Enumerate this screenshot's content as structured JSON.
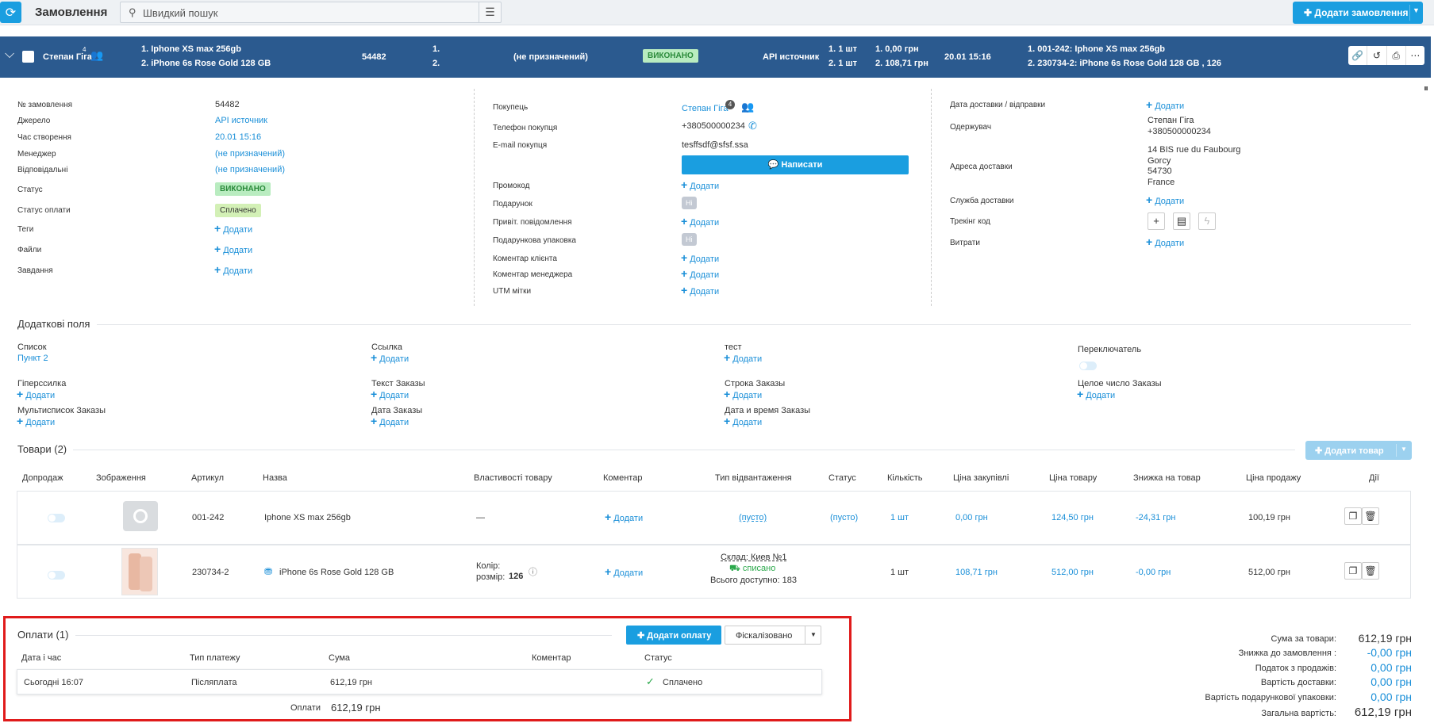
{
  "topbar": {
    "title": "Замовлення",
    "search_placeholder": "Швидкий пошук",
    "add_order_label": "Додати замовлення"
  },
  "order_header": {
    "client": "Степан Гіга",
    "client_badge": "4",
    "items_line1": "1. Iphone XS max 256gb",
    "items_line2": "2. iPhone 6s Rose Gold 128 GB",
    "order_id": "54482",
    "num1": "1.",
    "num2": "2.",
    "manager": "(не призначений)",
    "status": "ВИКОНАНО",
    "source": "API источник",
    "qty1": "1. 1 шт",
    "qty2": "2. 1 шт",
    "price1": "1. 0,00 грн",
    "price2": "2. 108,71 грн",
    "datetime": "20.01 15:16",
    "sku1": "1. 001-242: Iphone XS max 256gb",
    "sku2": "2. 230734-2: iPhone 6s Rose Gold 128 GB , 126"
  },
  "info_left": {
    "order_no_label": "№ замовлення",
    "order_no": "54482",
    "source_label": "Джерело",
    "source": "API источник",
    "created_label": "Час створення",
    "created": "20.01 15:16",
    "manager_label": "Менеджер",
    "manager": "(не призначений)",
    "responsible_label": "Відповідальні",
    "responsible": "(не призначений)",
    "status_label": "Статус",
    "status": "ВИКОНАНО",
    "pay_status_label": "Статус оплати",
    "pay_status": "Сплачено",
    "tags_label": "Теги",
    "files_label": "Файли",
    "tasks_label": "Завдання",
    "add": "Додати"
  },
  "info_mid": {
    "buyer_label": "Покупець",
    "buyer": "Степан Гіга",
    "buyer_badge": "4",
    "phone_label": "Телефон покупця",
    "phone": "+380500000234",
    "email_label": "E-mail покупця",
    "email": "tesffsdf@sfsf.ssa",
    "write_label": "Написати",
    "promo_label": "Промокод",
    "gift_label": "Подарунок",
    "gift": "Ні",
    "greet_label": "Привіт. повідомлення",
    "gift_pack_label": "Подарункова упаковка",
    "gift_pack": "Ні",
    "client_comment_label": "Коментар клієнта",
    "manager_comment_label": "Коментар менеджера",
    "utm_label": "UTM мітки",
    "add": "Додати"
  },
  "info_right": {
    "delivery_date_label": "Дата доставки / відправки",
    "recipient_label": "Одержувач",
    "recipient_name": "Степан Гіга",
    "recipient_phone": "+380500000234",
    "address_label": "Адреса доставки",
    "address1": "14 BIS rue du Faubourg",
    "address2": "Gorcy",
    "address3": "54730",
    "address4": "France",
    "delivery_service_label": "Служба доставки",
    "tracking_label": "Трекінг код",
    "expenses_label": "Витрати",
    "add": "Додати"
  },
  "extra_fields": {
    "title": "Додаткові поля",
    "list_label": "Список",
    "list_value": "Пункт 2",
    "link_label": "Ссылка",
    "test_label": "тест",
    "switch_label": "Переключатель",
    "hyperlink_label": "Гіперссилка",
    "text_label": "Текст Заказы",
    "string_label": "Строка Заказы",
    "int_label": "Целое число Заказы",
    "multi_label": "Мультисписок Заказы",
    "date_label": "Дата Заказы",
    "datetime_label": "Дата и время Заказы",
    "add": "Додати"
  },
  "products": {
    "title": "Товари (2)",
    "add_label": "Додати товар",
    "columns": [
      "Допродаж",
      "Зображення",
      "Артикул",
      "Назва",
      "Властивості товару",
      "Коментар",
      "Тип відвантаження",
      "Статус",
      "Кількість",
      "Ціна закупівлі",
      "Ціна товару",
      "Знижка на товар",
      "Ціна продажу",
      "Дії"
    ],
    "rows": [
      {
        "sku": "001-242",
        "name": "Iphone XS max 256gb",
        "props": "—",
        "comment": "Додати",
        "ship": "(пусто)",
        "status": "(пусто)",
        "qty": "1 шт",
        "purchase": "0,00 грн",
        "price": "124,50 грн",
        "discount": "-24,31 грн",
        "sale": "100,19 грн"
      },
      {
        "sku": "230734-2",
        "name": "iPhone 6s Rose Gold 128 GB",
        "props_color": "Колір:",
        "props_size_label": "розмір:",
        "props_size": "126",
        "comment": "Додати",
        "ship_store": "Склад: Киев №1",
        "ship_state": "списано",
        "ship_avail": "Всього доступно: 183",
        "qty": "1 шт",
        "purchase": "108,71 грн",
        "price": "512,00 грн",
        "discount": "-0,00 грн",
        "sale": "512,00 грн"
      }
    ]
  },
  "payments": {
    "title": "Оплати (1)",
    "add_label": "Додати оплату",
    "fiscal_label": "Фіскалізовано",
    "columns": [
      "Дата і час",
      "Тип платежу",
      "Сума",
      "Коментар",
      "Статус"
    ],
    "row": {
      "date": "Сьогодні 16:07",
      "type": "Післяплата",
      "sum": "612,19 грн",
      "status": "Сплачено"
    },
    "total_label": "Оплати",
    "total": "612,19 грн"
  },
  "totals": {
    "items_label": "Сума за товари:",
    "items": "612,19 грн",
    "discount_label": "Знижка до замовлення :",
    "discount": "-0,00 грн",
    "tax_label": "Податок з продажів:",
    "tax": "0,00 грн",
    "delivery_label": "Вартість доставки:",
    "delivery": "0,00 грн",
    "giftpack_label": "Вартість подарункової упаковки:",
    "giftpack": "0,00 грн",
    "total_label": "Загальна вартість:",
    "total": "612,19 грн"
  },
  "colors": {
    "accent": "#1a9ee0",
    "header": "#2b5a8f",
    "highlight": "#e01b1b"
  }
}
